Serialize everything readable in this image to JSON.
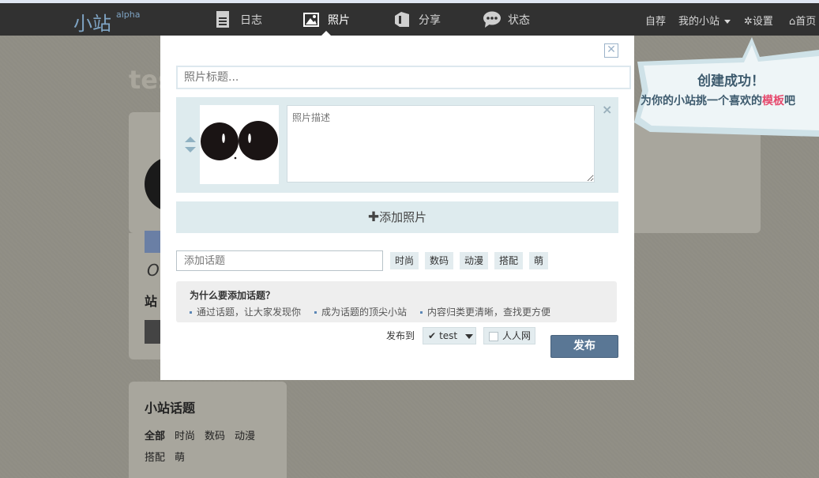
{
  "topbar": {
    "logo": "小站",
    "logo_sup": "alpha",
    "nav": [
      "日志",
      "照片",
      "分享",
      "状态"
    ],
    "active_nav": "照片",
    "right_links": [
      "自荐",
      "我的小站",
      "设置",
      "首页"
    ]
  },
  "background": {
    "site_title": "tes",
    "italic_initial": "O",
    "label": "站",
    "topics_title": "小站话题",
    "topics": [
      "全部",
      "时尚",
      "数码",
      "动漫",
      "搭配",
      "萌"
    ]
  },
  "modal": {
    "title_placeholder": "照片标题...",
    "desc_placeholder": "照片描述",
    "add_photo": "添加照片",
    "topic_placeholder": "添加话题",
    "tags": [
      "时尚",
      "数码",
      "动漫",
      "搭配",
      "萌"
    ],
    "why_title": "为什么要添加话题？",
    "why_items": [
      "通过话题，让大家发现你",
      "成为话题的顶尖小站",
      "内容归类更清晰，查找更方便"
    ],
    "publish_to": "发布到",
    "site_select": "test",
    "renren": "人人网",
    "publish": "发布"
  },
  "bubble": {
    "line1": "创建成功！",
    "line2_pre": "为你的小站挑一个喜欢的",
    "line2_hl": "模板",
    "line2_post": "吧"
  },
  "colors": {
    "topbar": "#313131",
    "accent": "#5a7795",
    "panel": "#deebee",
    "highlight": "#e64a6e"
  }
}
